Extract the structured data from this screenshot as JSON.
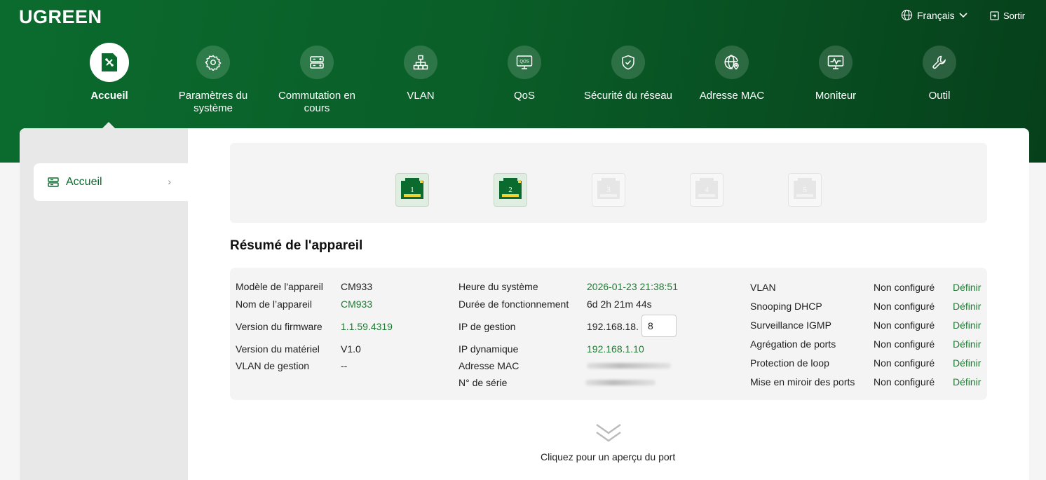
{
  "header": {
    "logo": "UGREEN",
    "language": "Français",
    "logout": "Sortir"
  },
  "nav": [
    {
      "label": "Accueil",
      "icon": "home-switch-icon",
      "active": true
    },
    {
      "label": "Paramètres du système",
      "icon": "gear-icon"
    },
    {
      "label": "Commutation en cours",
      "icon": "server-icon"
    },
    {
      "label": "VLAN",
      "icon": "network-topology-icon"
    },
    {
      "label": "QoS",
      "icon": "qos-monitor-icon"
    },
    {
      "label": "Sécurité du réseau",
      "icon": "shield-check-icon"
    },
    {
      "label": "Adresse MAC",
      "icon": "globe-pin-icon"
    },
    {
      "label": "Moniteur",
      "icon": "monitor-chart-icon"
    },
    {
      "label": "Outil",
      "icon": "wrench-icon"
    }
  ],
  "sidebar": {
    "items": [
      {
        "label": "Accueil",
        "icon": "list-icon"
      }
    ]
  },
  "ports": [
    {
      "number": "1",
      "status": "connected"
    },
    {
      "number": "2",
      "status": "connected"
    },
    {
      "number": "3",
      "status": "disconnected"
    },
    {
      "number": "4",
      "status": "disconnected"
    },
    {
      "number": "5",
      "status": "disconnected"
    }
  ],
  "summary": {
    "title": "Résumé de l'appareil",
    "model_label": "Modèle de l'appareil",
    "model": "CM933",
    "name_label": "Nom de l’appareil",
    "name": "CM933",
    "firmware_label": "Version du firmware",
    "firmware": "1.1.59.4319",
    "hardware_label": "Version du matériel",
    "hardware": "V1.0",
    "mgmt_vlan_label": "VLAN de gestion",
    "mgmt_vlan": "--",
    "time_label": "Heure du système",
    "time": "2026-01-23 21:38:51",
    "uptime_label": "Durée de fonctionnement",
    "uptime": "6d 2h 21m 44s",
    "mgmt_ip_label": "IP de gestion",
    "mgmt_ip_prefix": "192.168.18.",
    "mgmt_ip_last": "8",
    "dyn_ip_label": "IP dynamique",
    "dyn_ip": "192.168.1.10",
    "mac_label": "Adresse MAC",
    "serial_label": "N° de série",
    "features": [
      {
        "label": "VLAN",
        "status": "Non configuré",
        "action": "Définir"
      },
      {
        "label": "Snooping DHCP",
        "status": "Non configuré",
        "action": "Définir"
      },
      {
        "label": "Surveillance IGMP",
        "status": "Non configuré",
        "action": "Définir"
      },
      {
        "label": "Agrégation de ports",
        "status": "Non configuré",
        "action": "Définir"
      },
      {
        "label": "Protection de loop",
        "status": "Non configuré",
        "action": "Définir"
      },
      {
        "label": "Mise en miroir des ports",
        "status": "Non configuré",
        "action": "Définir"
      }
    ]
  },
  "footer": {
    "expand_label": "Cliquez pour un aperçu du port"
  },
  "colors": {
    "brand_green": "#0b6b2e",
    "value_green": "#1f7a33",
    "port_yellow": "#f2d22e"
  }
}
